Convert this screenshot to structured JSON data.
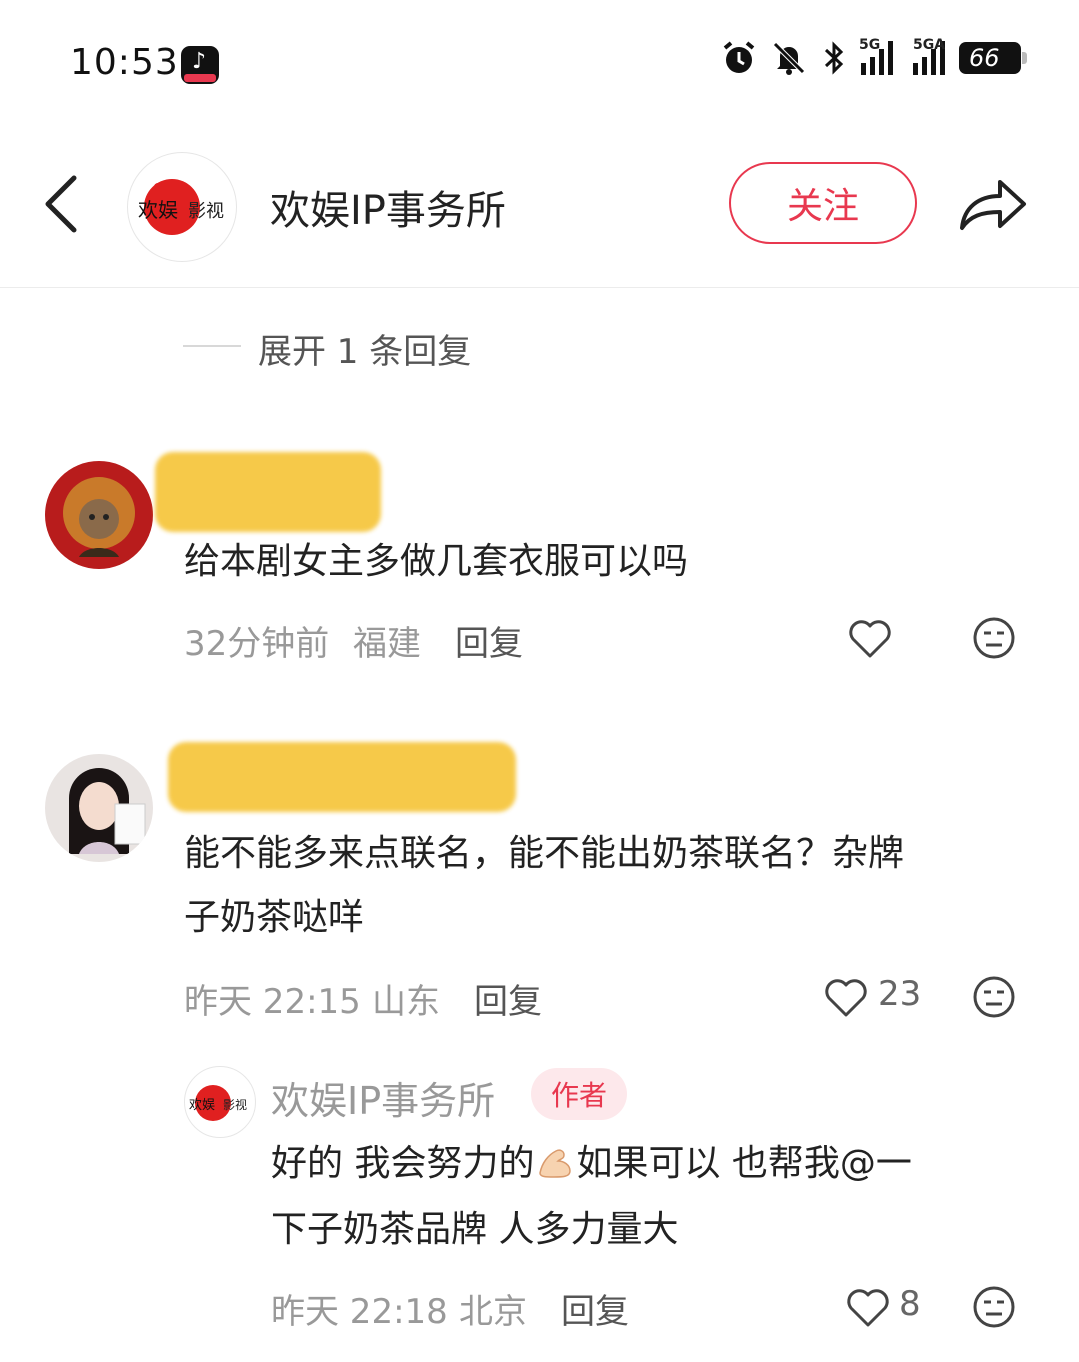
{
  "status_bar": {
    "time": "10:53",
    "battery": "66",
    "net1": "5G",
    "net2": "5GA"
  },
  "header": {
    "account_name": "欢娱IP事务所",
    "follow_label": "关注",
    "logo_text1": "欢娱",
    "logo_text2": "影视"
  },
  "expand": {
    "label": "展开 1 条回复"
  },
  "comments": [
    {
      "text": "给本剧女主多做几套衣服可以吗",
      "time": "32分钟前",
      "location": "福建",
      "reply_label": "回复",
      "likes": ""
    },
    {
      "text_line1": "能不能多来点联名，能不能出奶茶联名？杂牌",
      "text_line2": "子奶茶哒咩",
      "time": "昨天 22:15",
      "location": "山东",
      "reply_label": "回复",
      "likes": "23"
    }
  ],
  "author_reply": {
    "name": "欢娱IP事务所",
    "badge": "作者",
    "text_part1": "好的 我会努力的",
    "text_part2": "如果可以 也帮我@一",
    "text_line2": "下子奶茶品牌 人多力量大",
    "time": "昨天 22:18",
    "location": "北京",
    "reply_label": "回复",
    "likes": "8"
  },
  "colors": {
    "accent": "#e8384f",
    "text": "#222222",
    "muted": "#999999"
  }
}
